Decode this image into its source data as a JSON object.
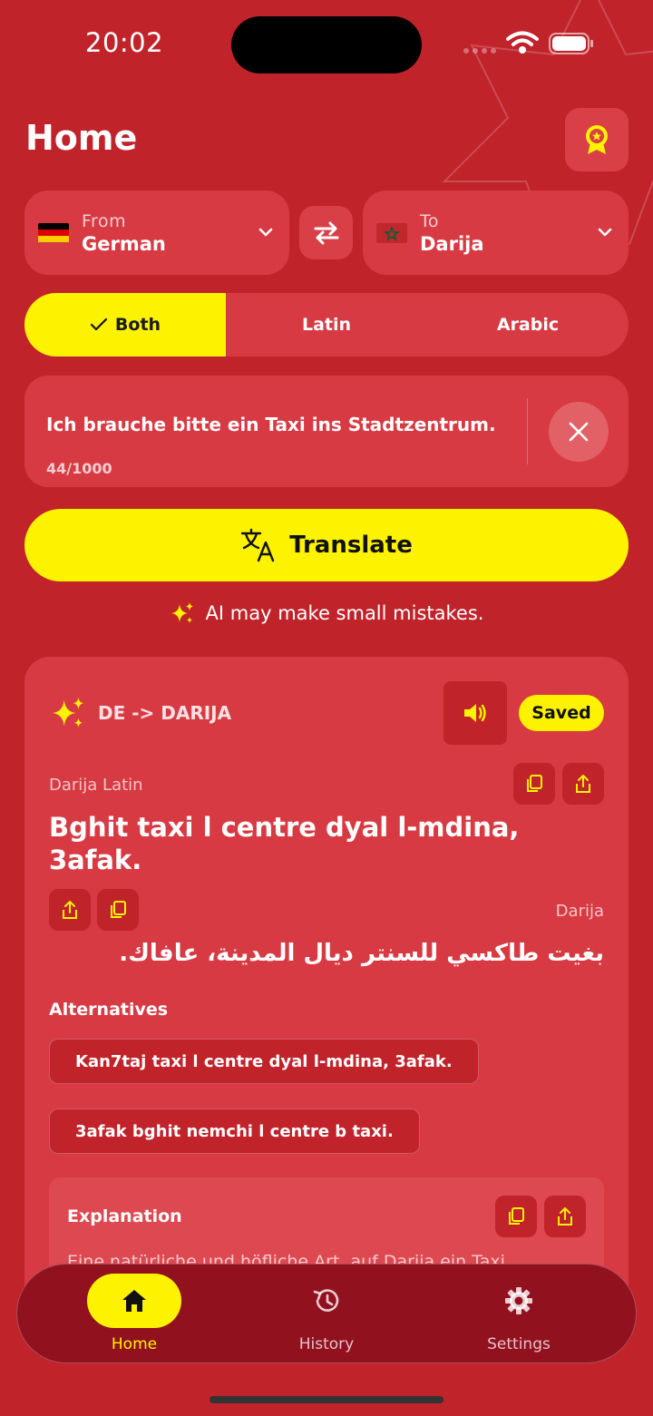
{
  "status": {
    "time": "20:02"
  },
  "header": {
    "title": "Home"
  },
  "languages": {
    "from_label": "From",
    "from_value": "German",
    "to_label": "To",
    "to_value": "Darija"
  },
  "script_modes": [
    {
      "label": "Both",
      "active": true
    },
    {
      "label": "Latin",
      "active": false
    },
    {
      "label": "Arabic",
      "active": false
    }
  ],
  "input": {
    "value": "Ich brauche bitte ein Taxi ins Stadtzentrum.",
    "counter": "44/1000"
  },
  "translate_button": "Translate",
  "ai_note": "AI may make small mistakes.",
  "result": {
    "direction": "DE -> DARIJA",
    "saved": "Saved",
    "latin_label": "Darija Latin",
    "latin_text": "Bghit taxi l centre dyal l-mdina, 3afak.",
    "arabic_label": "Darija",
    "arabic_text": "بغيت طاكسي للسنتر ديال المدينة، عافاك.",
    "alternatives_title": "Alternatives",
    "alternatives": [
      "Kan7taj taxi l centre dyal l-mdina, 3afak.",
      "3afak bghit nemchi l centre b taxi."
    ],
    "explanation_title": "Explanation",
    "explanation_text": "Eine natürliche und höfliche Art, auf Darija ein Taxi"
  },
  "nav": [
    {
      "label": "Home",
      "icon": "home-icon",
      "active": true
    },
    {
      "label": "History",
      "icon": "history-icon",
      "active": false
    },
    {
      "label": "Settings",
      "icon": "gear-icon",
      "active": false
    }
  ],
  "colors": {
    "primary": "#c1232b",
    "card": "#d83a43",
    "accent": "#fdf200",
    "nav": "#92111f"
  }
}
